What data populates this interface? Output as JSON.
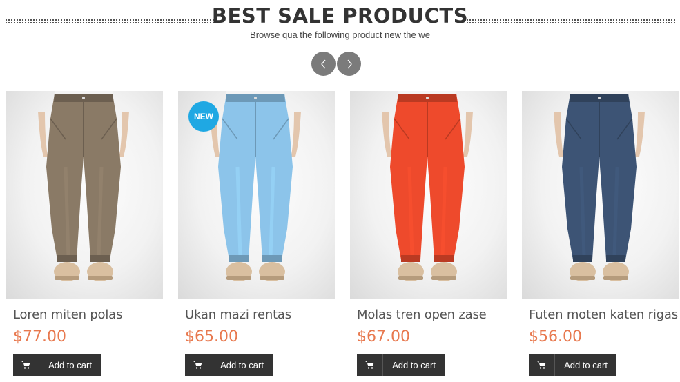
{
  "section": {
    "title": "BEST SALE PRODUCTS",
    "subtitle": "Browse qua the following product new the we"
  },
  "nav": {
    "prev_icon": "chevron-left-icon",
    "next_icon": "chevron-right-icon"
  },
  "colors": {
    "price": "#e8794f",
    "badge": "#1fa8e3",
    "button": "#333333",
    "nav": "#7b7b7b"
  },
  "products": [
    {
      "name": "Loren miten polas",
      "price": "$77.00",
      "badge": "",
      "pants_color": "#8a7a66",
      "cart_label": "Add to cart"
    },
    {
      "name": "Ukan mazi rentas",
      "price": "$65.00",
      "badge": "NEW",
      "pants_color": "#8cc4ea",
      "cart_label": "Add to cart"
    },
    {
      "name": "Molas tren open zase",
      "price": "$67.00",
      "badge": "",
      "pants_color": "#ee4a2c",
      "cart_label": "Add to cart"
    },
    {
      "name": "Futen moten katen rigas",
      "price": "$56.00",
      "badge": "",
      "pants_color": "#3d5475",
      "cart_label": "Add to cart"
    }
  ]
}
